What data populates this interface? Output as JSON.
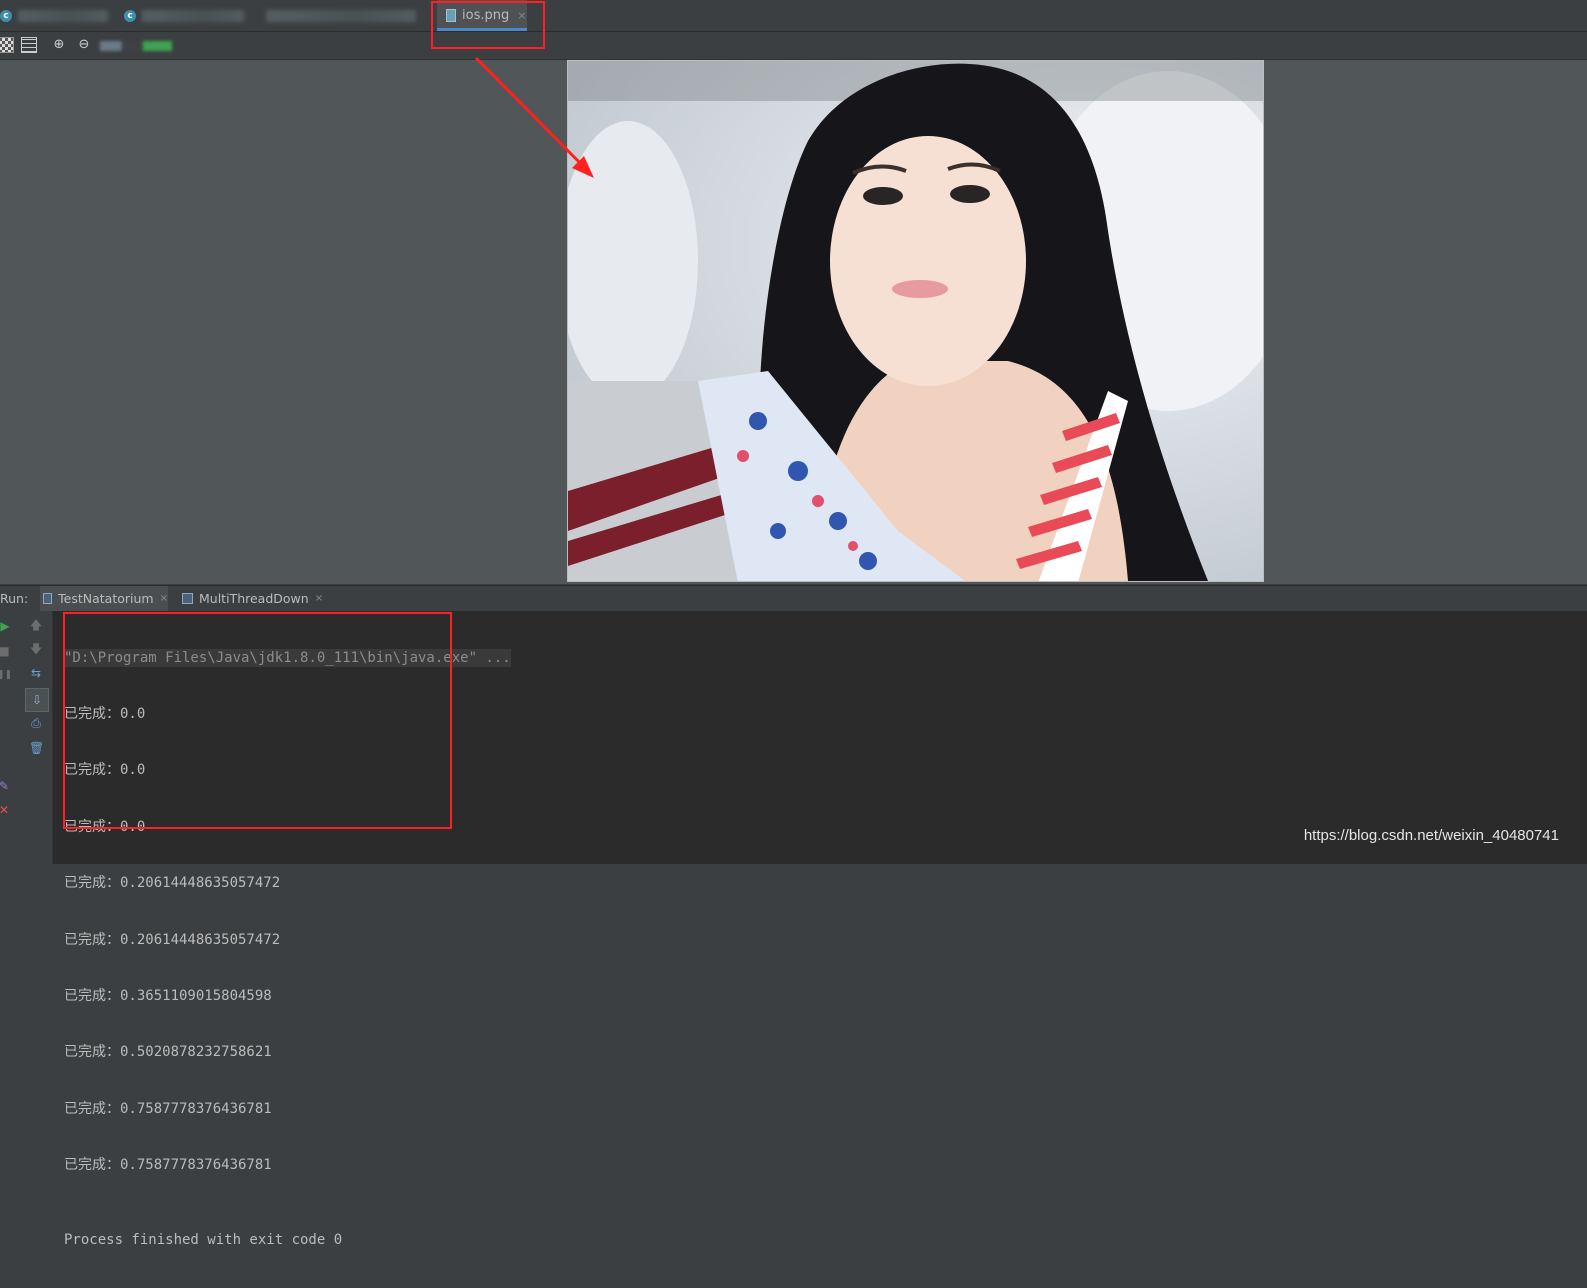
{
  "editor_tabs": {
    "active_tab_label": "ios.png",
    "close_glyph": "×"
  },
  "toolbar": {
    "zoom_in_glyph": "⊕",
    "zoom_out_glyph": "⊖"
  },
  "run_panel": {
    "label": "Run:",
    "tabs": [
      {
        "label": "TestNatatorium",
        "close": "×"
      },
      {
        "label": "MultiThreadDown",
        "close": "×"
      }
    ],
    "side_icons": {
      "rerun": "▶",
      "stop": "■",
      "pause": "❚❚",
      "up": "🡅",
      "down": "🡇",
      "wrap": "⇆",
      "scroll_end": "⇩",
      "print": "⎙",
      "trash": "🗑",
      "pin": "✎",
      "close": "✕"
    },
    "console": {
      "command": "\"D:\\Program Files\\Java\\jdk1.8.0_111\\bin\\java.exe\" ...",
      "lines": [
        "已完成：0.0",
        "已完成：0.0",
        "已完成：0.0",
        "已完成：0.20614448635057472",
        "已完成：0.20614448635057472",
        "已完成：0.3651109015804598",
        "已完成：0.5020878232758621",
        "已完成：0.7587778376436781",
        "已完成：0.7587778376436781"
      ],
      "exit_message": "Process finished with exit code 0"
    }
  },
  "watermark": "https://blog.csdn.net/weixin_40480741",
  "colors": {
    "annotation_red": "#ff2020",
    "tab_underline": "#4a88c7",
    "run_green": "#3fa352"
  }
}
